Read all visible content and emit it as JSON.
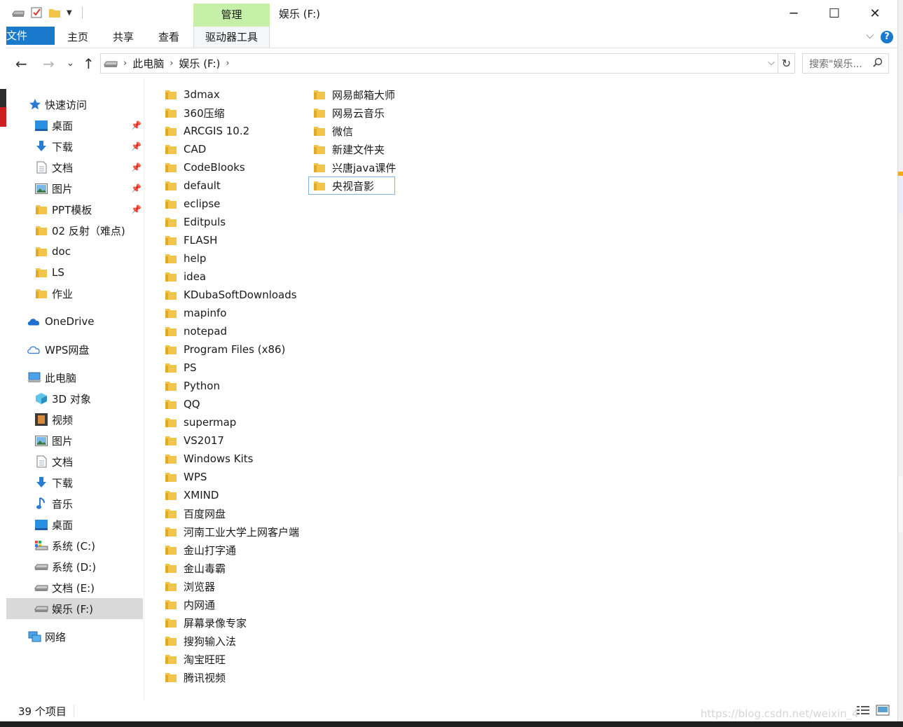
{
  "window": {
    "title": "娱乐 (F:)",
    "manage_tab": "管理",
    "controls": {
      "minimize": "─",
      "maximize": "☐",
      "close": "✕"
    }
  },
  "ribbon": {
    "tabs": [
      "文件",
      "主页",
      "共享",
      "查看"
    ],
    "tool_tab": "驱动器工具",
    "help": "?"
  },
  "address": {
    "crumbs": [
      "此电脑",
      "娱乐 (F:)"
    ],
    "search_placeholder": "搜索\"娱乐...",
    "search_icon": "magnifier-icon"
  },
  "nav_pane": {
    "quick_access": "快速访问",
    "quick_items": [
      {
        "label": "桌面",
        "icon": "desktop-icon",
        "pinned": true
      },
      {
        "label": "下载",
        "icon": "download-icon",
        "pinned": true
      },
      {
        "label": "文档",
        "icon": "document-icon",
        "pinned": true
      },
      {
        "label": "图片",
        "icon": "pictures-icon",
        "pinned": true
      },
      {
        "label": "PPT模板",
        "icon": "folder-icon",
        "pinned": true
      },
      {
        "label": "02 反射（难点)",
        "icon": "folder-icon",
        "pinned": false
      },
      {
        "label": "doc",
        "icon": "folder-icon",
        "pinned": false
      },
      {
        "label": "LS",
        "icon": "folder-icon",
        "pinned": false
      },
      {
        "label": "作业",
        "icon": "folder-icon",
        "pinned": false
      }
    ],
    "onedrive": "OneDrive",
    "wps_drive": "WPS网盘",
    "this_pc": "此电脑",
    "pc_items": [
      {
        "label": "3D 对象",
        "icon": "3d-objects-icon"
      },
      {
        "label": "视频",
        "icon": "videos-icon"
      },
      {
        "label": "图片",
        "icon": "pictures-icon"
      },
      {
        "label": "文档",
        "icon": "document-icon"
      },
      {
        "label": "下载",
        "icon": "download-icon"
      },
      {
        "label": "音乐",
        "icon": "music-icon"
      },
      {
        "label": "桌面",
        "icon": "desktop-icon"
      },
      {
        "label": "系统 (C:)",
        "icon": "system-drive-icon"
      },
      {
        "label": "系统 (D:)",
        "icon": "drive-icon"
      },
      {
        "label": "文档 (E:)",
        "icon": "drive-icon"
      },
      {
        "label": "娱乐 (F:)",
        "icon": "drive-icon",
        "selected": true
      }
    ],
    "network": "网络"
  },
  "files": {
    "column1": [
      "3dmax",
      "360压缩",
      "ARCGIS 10.2",
      "CAD",
      "CodeBlooks",
      "default",
      "eclipse",
      "Editpuls",
      "FLASH",
      "help",
      "idea",
      "KDubaSoftDownloads",
      "mapinfo",
      "notepad",
      "Program Files (x86)",
      "PS",
      "Python",
      "QQ",
      "supermap",
      "VS2017",
      "Windows Kits",
      "WPS",
      "XMIND",
      "百度网盘",
      "河南工业大学上网客户端",
      "金山打字通",
      "金山毒霸",
      "浏览器",
      "内网通",
      "屏幕录像专家",
      "搜狗输入法",
      "淘宝旺旺",
      "腾讯视频"
    ],
    "column2": [
      "网易邮箱大师",
      "网易云音乐",
      "微信",
      "新建文件夹",
      "兴唐java课件",
      "央视音影"
    ],
    "focused": "央视音影"
  },
  "status": {
    "item_count": "39 个项目",
    "watermark": "https://blog.csdn.net/weixin_4"
  },
  "colors": {
    "accent": "#1979ca",
    "manage_green": "#c6efa8",
    "folder": "#f3c44a",
    "selected_bg": "#d9d9d9"
  }
}
